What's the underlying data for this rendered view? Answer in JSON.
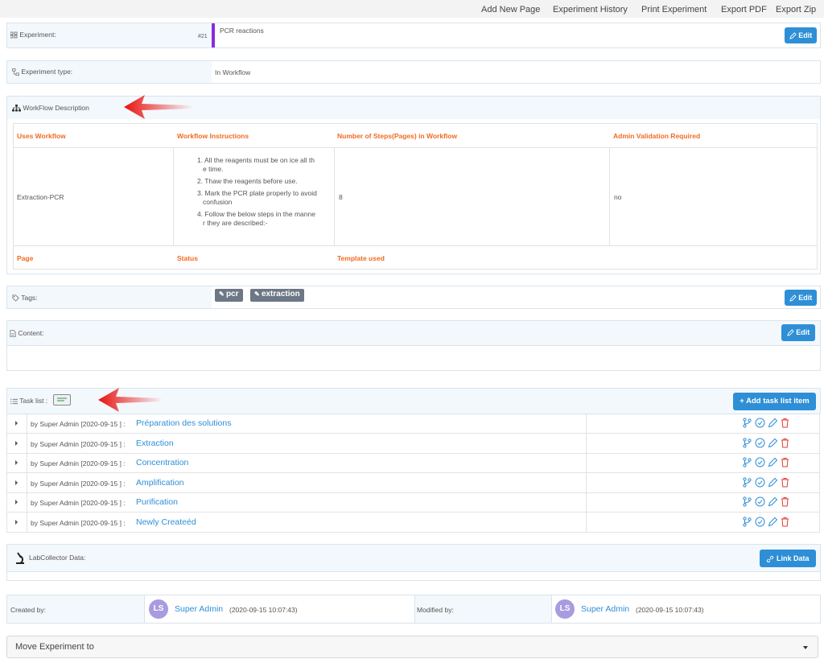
{
  "topnav": [
    "Add New Page",
    "Experiment History",
    "Print Experiment",
    "Export PDF",
    "Export Zip"
  ],
  "experiment": {
    "label": "Experiment:",
    "number": "#21",
    "name": "PCR reactions",
    "edit": "Edit"
  },
  "experiment_type": {
    "label": "Experiment type:",
    "value": "In Workflow"
  },
  "workflow": {
    "title": "WorkFlow Description",
    "headers": [
      "Uses Workflow",
      "Workflow Instructions",
      "Number of Steps(Pages) in Workflow",
      "Admin Validation Required"
    ],
    "uses": "Extraction-PCR",
    "instructions": [
      [
        "1. All the reagents must be on ice all th",
        "e time."
      ],
      [
        "2. Thaw the reagents before use."
      ],
      [
        "3. Mark the PCR plate properly to avoid",
        "confusion"
      ],
      [
        "4. Follow the below steps in the manne",
        "r they are described:-"
      ]
    ],
    "steps": "8",
    "admin_validation": "no",
    "footer_headers": [
      "Page",
      "Status",
      "Template used"
    ]
  },
  "tags": {
    "label": "Tags:",
    "items": [
      "pcr",
      "extraction"
    ],
    "edit": "Edit"
  },
  "content": {
    "label": "Content:",
    "edit": "Edit"
  },
  "tasks": {
    "label": "Task list :",
    "add_button": "+ Add task list item",
    "items": [
      {
        "by": "by Super Admin [2020-09-15 ] :",
        "title": "Préparation des solutions"
      },
      {
        "by": "by Super Admin [2020-09-15 ] :",
        "title": "Extraction"
      },
      {
        "by": "by Super Admin [2020-09-15 ] :",
        "title": "Concentration"
      },
      {
        "by": "by Super Admin [2020-09-15 ] :",
        "title": "Amplification"
      },
      {
        "by": "by Super Admin [2020-09-15 ] :",
        "title": "Purification"
      },
      {
        "by": "by Super Admin [2020-09-15 ] :",
        "title": "Newly Createéd"
      }
    ]
  },
  "labcollector": {
    "label": "LabCollector Data:",
    "link_button": "Link Data"
  },
  "created": {
    "label": "Created by:",
    "initials": "LS",
    "name": "Super Admin",
    "date": "(2020-09-15 10:07:43)"
  },
  "modified": {
    "label": "Modified by:",
    "initials": "LS",
    "name": "Super Admin",
    "date": "(2020-09-15 10:07:43)"
  },
  "move": {
    "label": "Move Experiment to"
  },
  "colors": {
    "accent": "#2e8fd6",
    "header_orange": "#f26a22",
    "purple_marker": "#8a2be2",
    "arrow_red": "#e8130f"
  }
}
